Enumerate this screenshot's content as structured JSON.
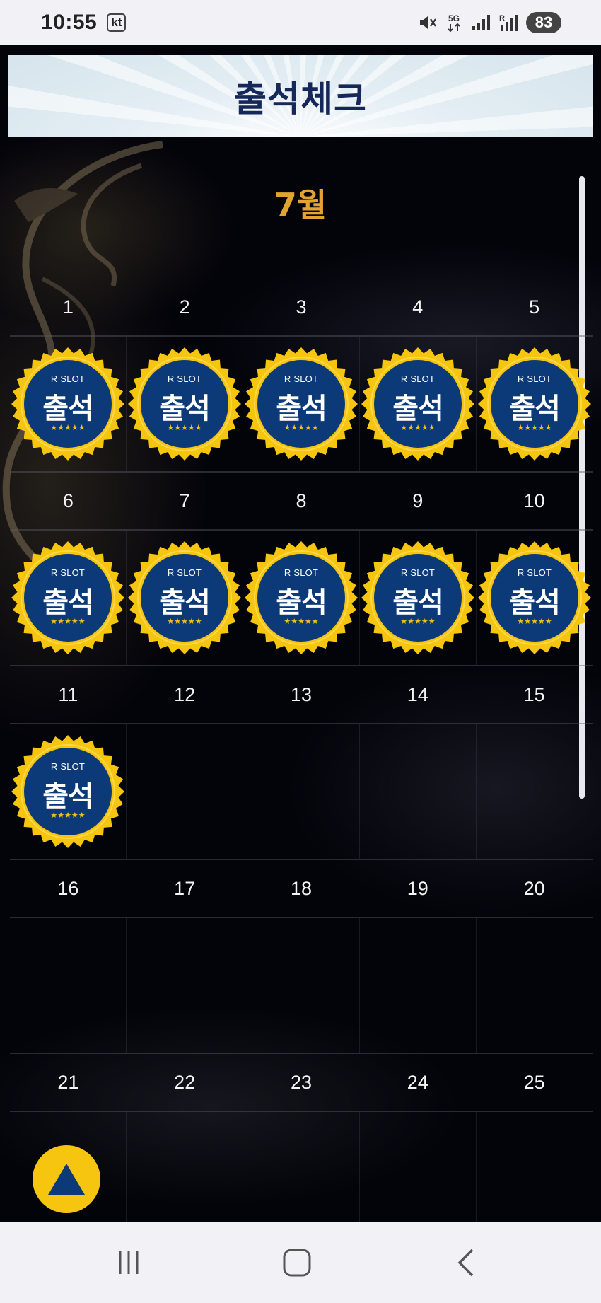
{
  "status_bar": {
    "time": "10:55",
    "carrier": "kt",
    "network": "5G",
    "battery": "83"
  },
  "header": {
    "title": "출석체크"
  },
  "calendar": {
    "month": "7월",
    "weeks": [
      {
        "days": [
          "1",
          "2",
          "3",
          "4",
          "5"
        ]
      },
      {
        "days": [
          "6",
          "7",
          "8",
          "9",
          "10"
        ]
      },
      {
        "days": [
          "11",
          "12",
          "13",
          "14",
          "15"
        ]
      },
      {
        "days": [
          "16",
          "17",
          "18",
          "19",
          "20"
        ]
      },
      {
        "days": [
          "21",
          "22",
          "23",
          "24",
          "25"
        ]
      }
    ]
  },
  "stamp": {
    "brand": "R SLOT",
    "text": "출석",
    "stars": "★★★★★"
  },
  "colors": {
    "title_blue": "#16285a",
    "month_gold": "#e2a431",
    "stamp_gold": "#f5c50f",
    "stamp_blue": "#0c3a78"
  }
}
